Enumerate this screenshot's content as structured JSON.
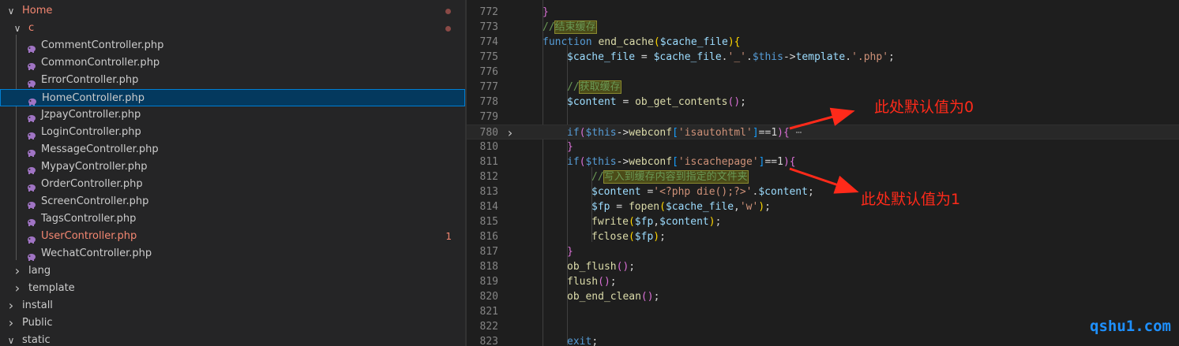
{
  "explorer": {
    "items": [
      {
        "label": "Home",
        "depth": 0,
        "expanded": true,
        "folder": true,
        "status": "error",
        "dot": true
      },
      {
        "label": "c",
        "depth": 1,
        "expanded": true,
        "folder": true,
        "status": "error",
        "dot": true
      },
      {
        "label": "CommentController.php",
        "depth": 2,
        "icon": "php-elephant-icon"
      },
      {
        "label": "CommonController.php",
        "depth": 2,
        "icon": "php-elephant-icon"
      },
      {
        "label": "ErrorController.php",
        "depth": 2,
        "icon": "php-elephant-icon"
      },
      {
        "label": "HomeController.php",
        "depth": 2,
        "icon": "php-elephant-icon",
        "selected": true
      },
      {
        "label": "JzpayController.php",
        "depth": 2,
        "icon": "php-elephant-icon"
      },
      {
        "label": "LoginController.php",
        "depth": 2,
        "icon": "php-elephant-icon"
      },
      {
        "label": "MessageController.php",
        "depth": 2,
        "icon": "php-elephant-icon"
      },
      {
        "label": "MypayController.php",
        "depth": 2,
        "icon": "php-elephant-icon"
      },
      {
        "label": "OrderController.php",
        "depth": 2,
        "icon": "php-elephant-icon"
      },
      {
        "label": "ScreenController.php",
        "depth": 2,
        "icon": "php-elephant-icon"
      },
      {
        "label": "TagsController.php",
        "depth": 2,
        "icon": "php-elephant-icon"
      },
      {
        "label": "UserController.php",
        "depth": 2,
        "icon": "php-elephant-icon",
        "status": "error",
        "badge": "1"
      },
      {
        "label": "WechatController.php",
        "depth": 2,
        "icon": "php-elephant-icon"
      },
      {
        "label": "lang",
        "depth": 1,
        "expanded": false,
        "folder": true
      },
      {
        "label": "template",
        "depth": 1,
        "expanded": false,
        "folder": true
      },
      {
        "label": "install",
        "depth": 0,
        "expanded": false,
        "folder": true
      },
      {
        "label": "Public",
        "depth": 0,
        "expanded": false,
        "folder": true
      },
      {
        "label": "static",
        "depth": 0,
        "expanded": true,
        "folder": true
      }
    ]
  },
  "editor": {
    "lines": [
      {
        "num": "772",
        "indent": 2,
        "tokens": [
          [
            "br",
            "}"
          ]
        ]
      },
      {
        "num": "773",
        "indent": 2,
        "tokens": [
          [
            "cm",
            "//"
          ],
          [
            "cjk",
            "结束缓存"
          ]
        ]
      },
      {
        "num": "774",
        "indent": 2,
        "tokens": [
          [
            "kw",
            "function "
          ],
          [
            "fn",
            "end_cache"
          ],
          [
            "br3",
            "("
          ],
          [
            "var",
            "$cache_file"
          ],
          [
            "br3",
            "){"
          ]
        ]
      },
      {
        "num": "775",
        "indent": 3,
        "tokens": [
          [
            "var",
            "$cache_file"
          ],
          [
            "op",
            " = "
          ],
          [
            "var",
            "$cache_file"
          ],
          [
            "op",
            "."
          ],
          [
            "str",
            "'_'"
          ],
          [
            "op",
            "."
          ],
          [
            "kw",
            "$this"
          ],
          [
            "op",
            "->"
          ],
          [
            "var",
            "template"
          ],
          [
            "op",
            "."
          ],
          [
            "str",
            "'.php'"
          ],
          [
            "op",
            ";"
          ]
        ]
      },
      {
        "num": "776",
        "indent": 3,
        "tokens": []
      },
      {
        "num": "777",
        "indent": 3,
        "tokens": [
          [
            "cm",
            "//"
          ],
          [
            "cjk",
            "获取缓存"
          ]
        ]
      },
      {
        "num": "778",
        "indent": 3,
        "tokens": [
          [
            "var",
            "$content"
          ],
          [
            "op",
            " = "
          ],
          [
            "fn",
            "ob_get_contents"
          ],
          [
            "br",
            "()"
          ],
          [
            "op",
            ";"
          ]
        ]
      },
      {
        "num": "779",
        "indent": 3,
        "tokens": []
      },
      {
        "num": "780",
        "indent": 3,
        "folded": true,
        "highlight": true,
        "tokens": [
          [
            "kw",
            "if"
          ],
          [
            "br",
            "("
          ],
          [
            "kw",
            "$this"
          ],
          [
            "op",
            "->"
          ],
          [
            "fn",
            "webconf"
          ],
          [
            "br2",
            "["
          ],
          [
            "str",
            "'isautohtml'"
          ],
          [
            "br2",
            "]"
          ],
          [
            "op",
            "=="
          ],
          [
            "op",
            "1"
          ],
          [
            "br",
            ")"
          ],
          [
            "br",
            "{"
          ],
          [
            "fold",
            " ⋯"
          ]
        ]
      },
      {
        "num": "810",
        "indent": 3,
        "tokens": [
          [
            "br",
            "}"
          ]
        ]
      },
      {
        "num": "811",
        "indent": 3,
        "tokens": [
          [
            "kw",
            "if"
          ],
          [
            "br",
            "("
          ],
          [
            "kw",
            "$this"
          ],
          [
            "op",
            "->"
          ],
          [
            "fn",
            "webconf"
          ],
          [
            "br2",
            "["
          ],
          [
            "str",
            "'iscachepage'"
          ],
          [
            "br2",
            "]"
          ],
          [
            "op",
            "=="
          ],
          [
            "op",
            "1"
          ],
          [
            "br",
            ")"
          ],
          [
            "br",
            "{"
          ]
        ]
      },
      {
        "num": "812",
        "indent": 4,
        "tokens": [
          [
            "cm",
            "//"
          ],
          [
            "cjk",
            "写入到缓存内容到指定的文件夹"
          ]
        ]
      },
      {
        "num": "813",
        "indent": 4,
        "tokens": [
          [
            "var",
            "$content"
          ],
          [
            "op",
            " ="
          ],
          [
            "str",
            "'<?php die();?>'"
          ],
          [
            "op",
            "."
          ],
          [
            "var",
            "$content"
          ],
          [
            "op",
            ";"
          ]
        ]
      },
      {
        "num": "814",
        "indent": 4,
        "tokens": [
          [
            "var",
            "$fp"
          ],
          [
            "op",
            " = "
          ],
          [
            "fn",
            "fopen"
          ],
          [
            "br3",
            "("
          ],
          [
            "var",
            "$cache_file"
          ],
          [
            "op",
            ","
          ],
          [
            "str",
            "'w'"
          ],
          [
            "br3",
            ")"
          ],
          [
            "op",
            ";"
          ]
        ]
      },
      {
        "num": "815",
        "indent": 4,
        "tokens": [
          [
            "fn",
            "fwrite"
          ],
          [
            "br3",
            "("
          ],
          [
            "var",
            "$fp"
          ],
          [
            "op",
            ","
          ],
          [
            "var",
            "$content"
          ],
          [
            "br3",
            ")"
          ],
          [
            "op",
            ";"
          ]
        ]
      },
      {
        "num": "816",
        "indent": 4,
        "tokens": [
          [
            "fn",
            "fclose"
          ],
          [
            "br3",
            "("
          ],
          [
            "var",
            "$fp"
          ],
          [
            "br3",
            ")"
          ],
          [
            "op",
            ";"
          ]
        ]
      },
      {
        "num": "817",
        "indent": 3,
        "tokens": [
          [
            "br",
            "}"
          ]
        ]
      },
      {
        "num": "818",
        "indent": 3,
        "tokens": [
          [
            "fn",
            "ob_flush"
          ],
          [
            "br",
            "()"
          ],
          [
            "op",
            ";"
          ]
        ]
      },
      {
        "num": "819",
        "indent": 3,
        "tokens": [
          [
            "fn",
            "flush"
          ],
          [
            "br",
            "()"
          ],
          [
            "op",
            ";"
          ]
        ]
      },
      {
        "num": "820",
        "indent": 3,
        "tokens": [
          [
            "fn",
            "ob_end_clean"
          ],
          [
            "br",
            "()"
          ],
          [
            "op",
            ";"
          ]
        ]
      },
      {
        "num": "821",
        "indent": 3,
        "tokens": []
      },
      {
        "num": "822",
        "indent": 3,
        "tokens": []
      },
      {
        "num": "823",
        "indent": 3,
        "tokens": [
          [
            "kw",
            "exit"
          ],
          [
            "op",
            ";"
          ]
        ]
      }
    ]
  },
  "annotations": {
    "first": "此处默认值为0",
    "second": "此处默认值为1",
    "color": "#ff2a1a"
  },
  "watermark": "qshu1.com",
  "colors": {
    "sidebar_bg": "#252526",
    "editor_bg": "#1e1e1e",
    "selection_border": "#007fd4",
    "error_text": "#f48771"
  }
}
